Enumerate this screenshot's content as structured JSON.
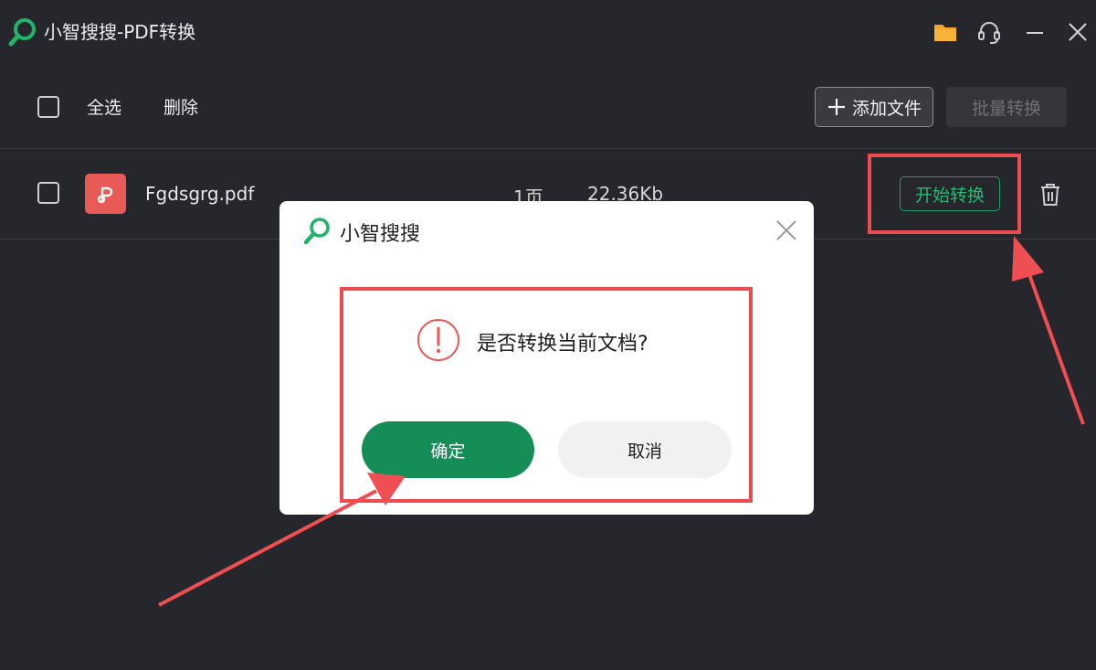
{
  "app": {
    "title": "小智搜搜-PDF转换"
  },
  "window_controls": {
    "folder_icon": "folder-icon",
    "support_icon": "headset-icon",
    "minimize_icon": "minimize-icon",
    "close_icon": "close-icon"
  },
  "toolbar": {
    "select_all_label": "全选",
    "delete_label": "删除",
    "add_file_label": "添加文件",
    "batch_convert_label": "批量转换"
  },
  "files": [
    {
      "name": "Fgdsgrg.pdf",
      "pages": "1页",
      "size": "22.36Kb",
      "start_label": "开始转换"
    }
  ],
  "dialog": {
    "title": "小智搜搜",
    "message": "是否转换当前文档?",
    "ok_label": "确定",
    "cancel_label": "取消"
  },
  "colors": {
    "background": "#26272c",
    "accent_green": "#148e56",
    "highlight_red": "#ea4c4f",
    "pdf_icon": "#e85a55",
    "folder": "#f5a623"
  }
}
